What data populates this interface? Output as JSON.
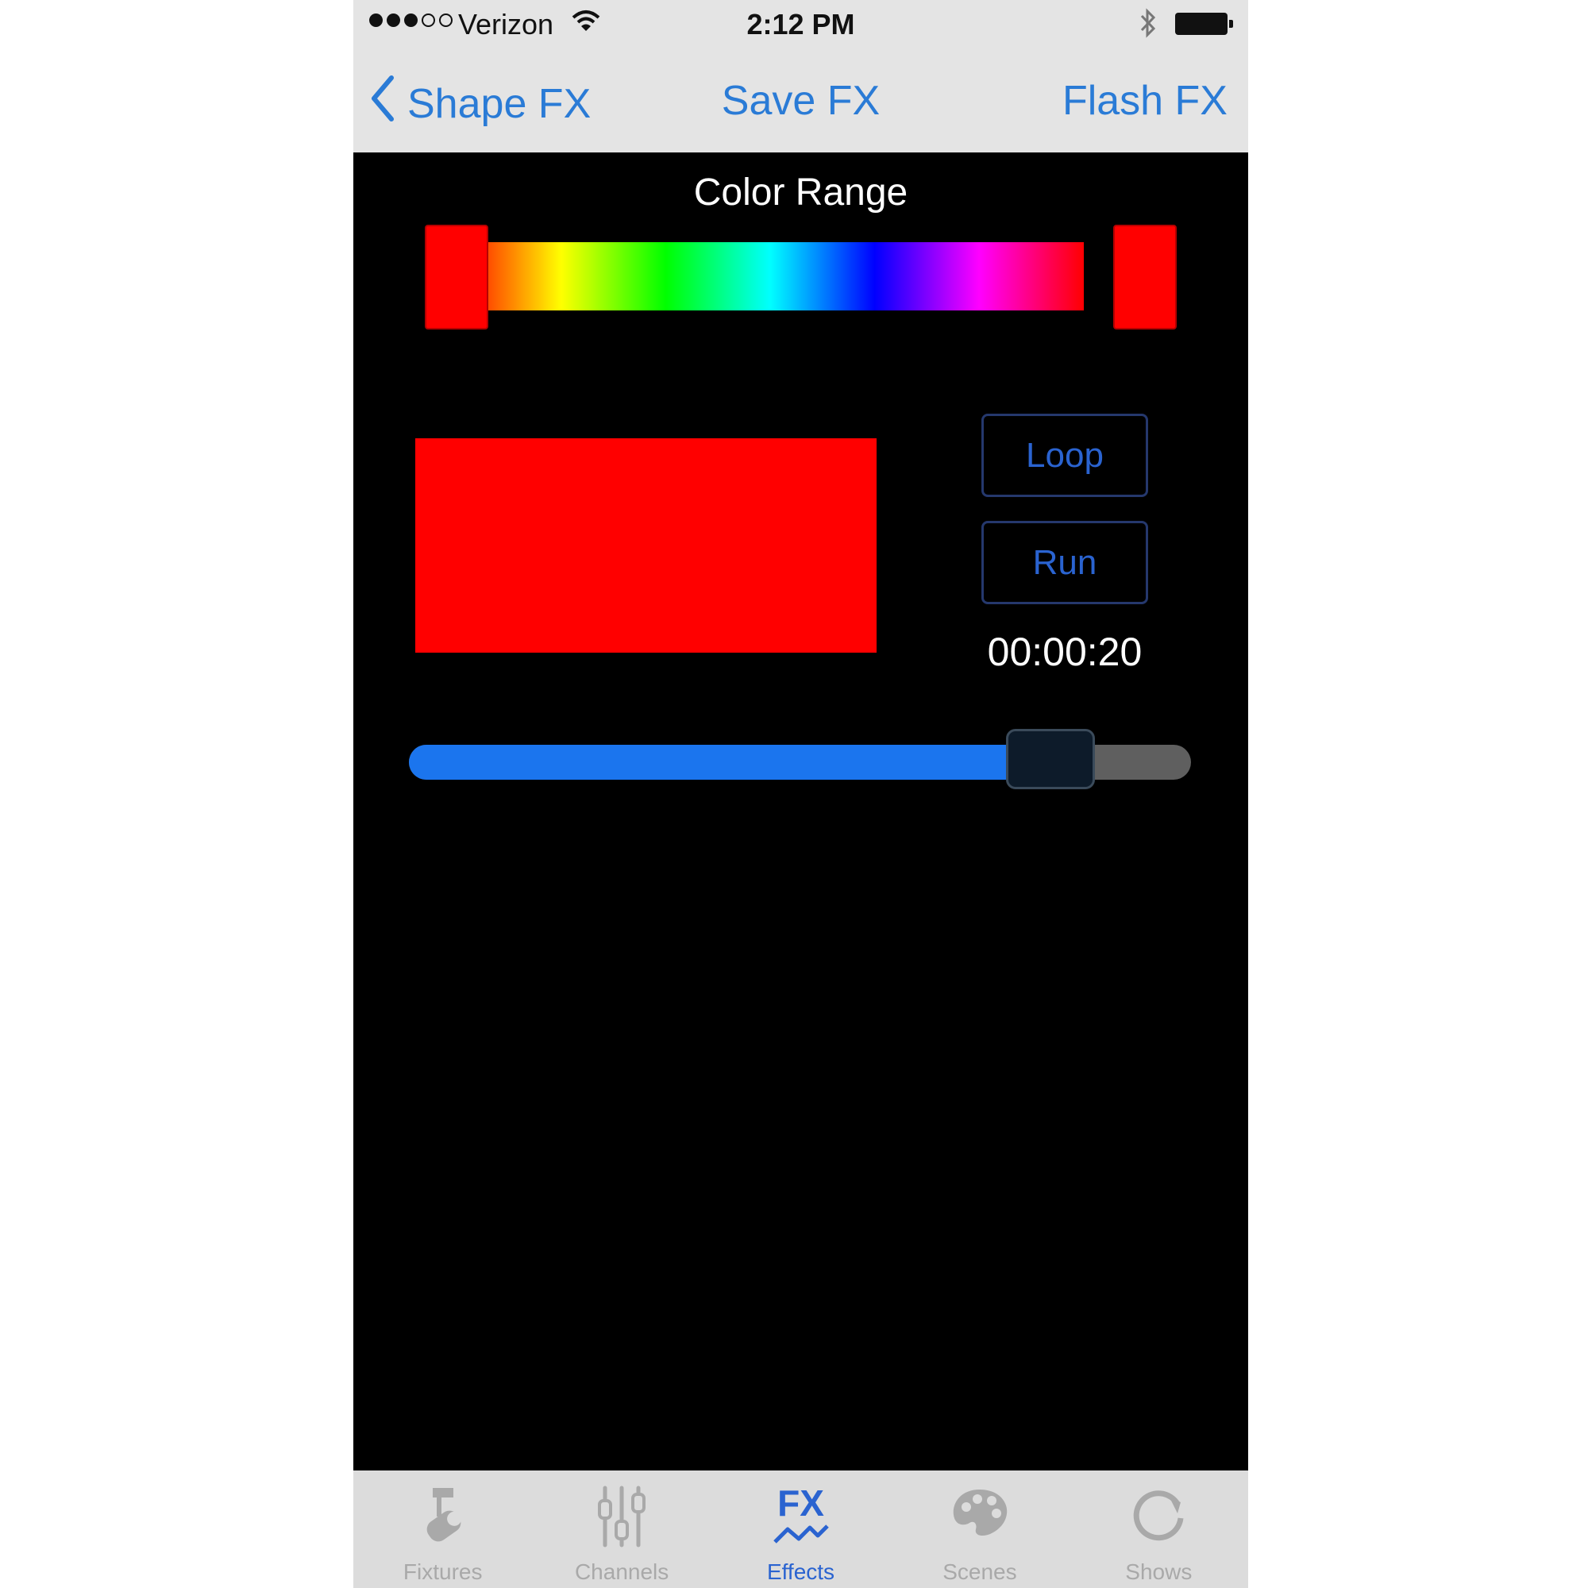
{
  "status_bar": {
    "signal_bars_filled": 3,
    "signal_bars_total": 5,
    "carrier": "Verizon",
    "time": "2:12 PM",
    "icons": [
      "wifi-icon",
      "bluetooth-icon",
      "battery-icon"
    ]
  },
  "nav": {
    "back_label": "Shape FX",
    "title": "Save FX",
    "right_label": "Flash FX",
    "color": "#2a7bd6"
  },
  "color_range": {
    "title": "Color Range",
    "spectrum": [
      "#ff0000",
      "#ffff00",
      "#00ff00",
      "#00ffff",
      "#0000ff",
      "#ff00ff",
      "#ff0000"
    ],
    "handle_color": "#ff0000"
  },
  "preview": {
    "color": "#ff0000"
  },
  "controls": {
    "loop_label": "Loop",
    "run_label": "Run",
    "timer": "00:00:20"
  },
  "slider": {
    "value": 0.82,
    "fill_color": "#1b75ee"
  },
  "tabs": [
    {
      "label": "Fixtures",
      "icon": "fixture-icon",
      "active": false
    },
    {
      "label": "Channels",
      "icon": "sliders-icon",
      "active": false
    },
    {
      "label": "Effects",
      "icon": "fx-icon",
      "active": true
    },
    {
      "label": "Scenes",
      "icon": "palette-icon",
      "active": false
    },
    {
      "label": "Shows",
      "icon": "loop-icon",
      "active": false
    }
  ]
}
